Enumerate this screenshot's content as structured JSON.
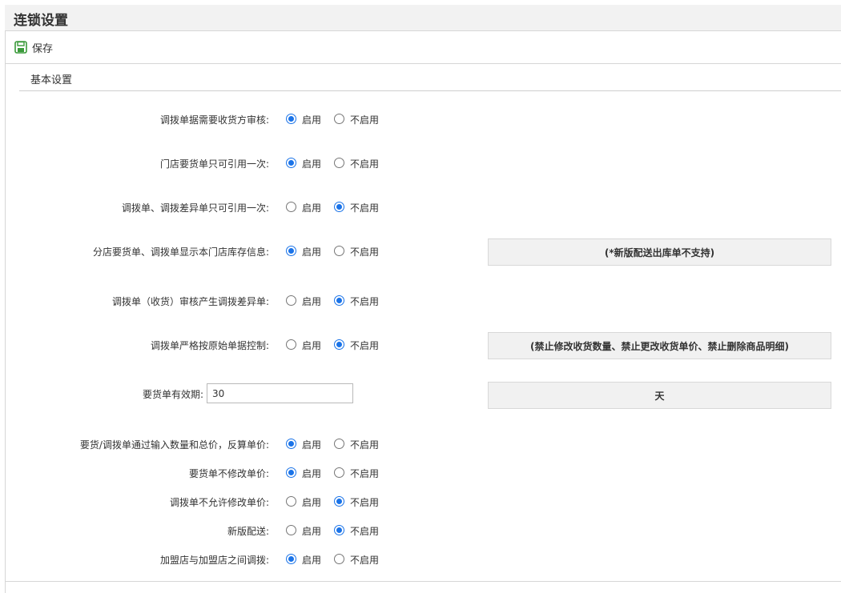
{
  "header": {
    "title": "连锁设置"
  },
  "toolbar": {
    "save_label": "保存",
    "save_icon": "save-icon"
  },
  "section": {
    "title": "基本设置"
  },
  "options": {
    "enable": "启用",
    "disable": "不启用"
  },
  "settings": [
    {
      "label": "调拨单据需要收货方审核:",
      "enabled": true
    },
    {
      "label": "门店要货单只可引用一次:",
      "enabled": true
    },
    {
      "label": "调拨单、调拨差异单只可引用一次:",
      "enabled": false
    },
    {
      "label": "分店要货单、调拨单显示本门店库存信息:",
      "enabled": true,
      "note": "(*新版配送出库单不支持)"
    },
    {
      "label": "调拨单（收货）审核产生调拨差异单:",
      "enabled": false
    },
    {
      "label": "调拨单严格按原始单据控制:",
      "enabled": false,
      "note": "(禁止修改收货数量、禁止更改收货单价、禁止删除商品明细)"
    },
    {
      "label": "要货/调拨单通过输入数量和总价，反算单价:",
      "enabled": true
    },
    {
      "label": "要货单不修改单价:",
      "enabled": true
    },
    {
      "label": "调拨单不允许修改单价:",
      "enabled": false
    },
    {
      "label": "新版配送:",
      "enabled": false
    },
    {
      "label": "加盟店与加盟店之间调拨:",
      "enabled": true
    }
  ],
  "validity": {
    "label": "要货单有效期:",
    "value": "30",
    "unit": "天"
  },
  "colors": {
    "accent": "#1a73e8",
    "save_icon": "#3a9a3a"
  }
}
